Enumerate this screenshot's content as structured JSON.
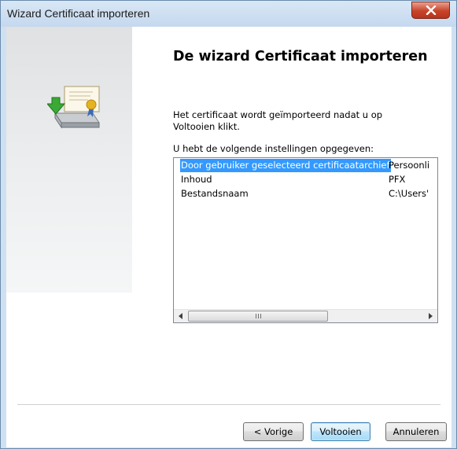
{
  "window": {
    "title": "Wizard Certificaat importeren",
    "close_label": "X"
  },
  "content": {
    "heading": "De wizard Certificaat importeren",
    "description": "Het certificaat wordt geïmporteerd nadat u op Voltooien klikt.",
    "list_label": "U hebt de volgende instellingen opgegeven:"
  },
  "list": {
    "rows": [
      {
        "name": "Door gebruiker geselecteerd certificaatarchief",
        "value": "Persoonli",
        "selected": true
      },
      {
        "name": "Inhoud",
        "value": "PFX",
        "selected": false
      },
      {
        "name": "Bestandsnaam",
        "value": "C:\\Users'",
        "selected": false
      }
    ],
    "scroll_grip": "III"
  },
  "buttons": {
    "back": "< Vorige",
    "finish": "Voltooien",
    "cancel": "Annuleren"
  },
  "icons": {
    "wizard": "certificate-import-icon",
    "close": "close-icon",
    "scroll_left": "scroll-left-arrow-icon",
    "scroll_right": "scroll-right-arrow-icon"
  },
  "colors": {
    "selection": "#3399ff",
    "close_button": "#c7442a",
    "default_button_border": "#3c7fb1"
  }
}
